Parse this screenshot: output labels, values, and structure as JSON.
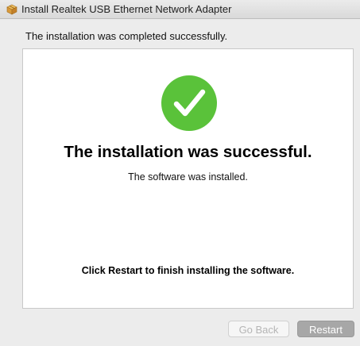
{
  "window": {
    "title": "Install Realtek USB Ethernet Network Adapter",
    "icon": "package-icon"
  },
  "subheader": "The installation was completed successfully.",
  "main": {
    "status_icon": "checkmark-icon",
    "status_color": "#5ac23a",
    "headline": "The installation was successful.",
    "message": "The software was installed.",
    "instruction": "Click Restart to finish installing the software."
  },
  "buttons": {
    "back_label": "Go Back",
    "restart_label": "Restart"
  }
}
